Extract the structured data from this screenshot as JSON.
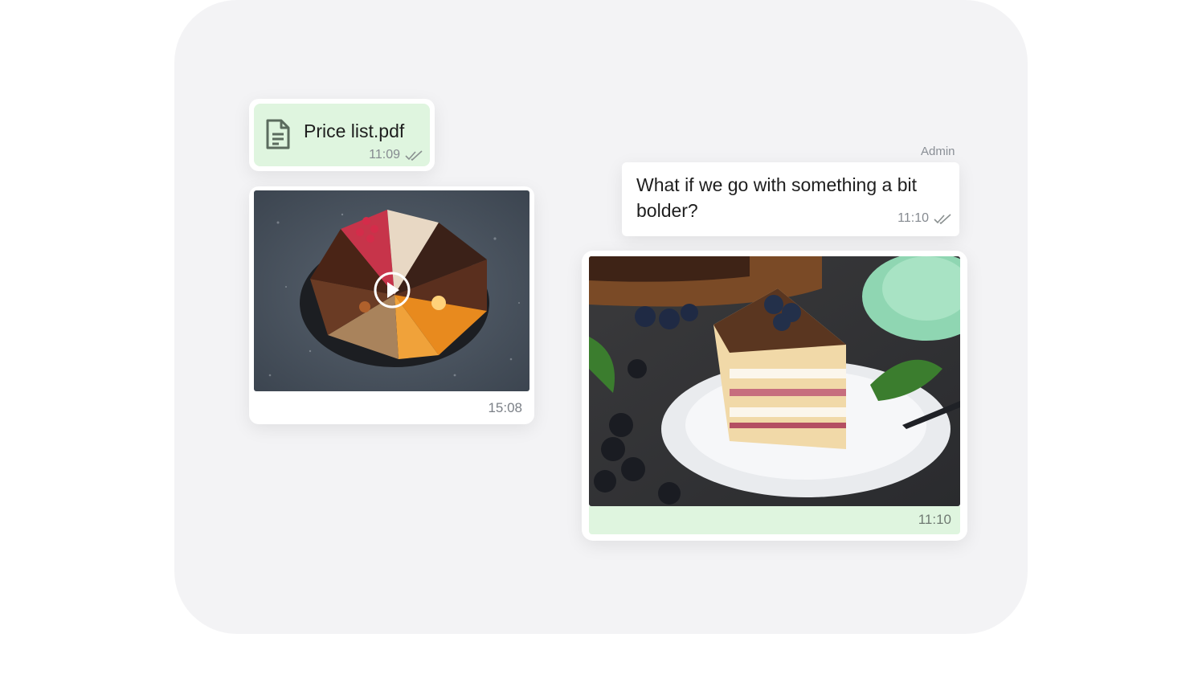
{
  "messages": {
    "file": {
      "name": "Price list.pdf",
      "time": "11:09",
      "icon": "document-icon",
      "status_icon": "double-check-icon"
    },
    "video": {
      "time": "15:08",
      "icon": "play-icon"
    },
    "admin_text": {
      "sender": "Admin",
      "text": "What if we go with something a bit bolder?",
      "time": "11:10",
      "status_icon": "double-check-icon"
    },
    "photo": {
      "time": "11:10"
    }
  },
  "colors": {
    "panel": "#f3f3f5",
    "outgoing_bubble": "#dff5df",
    "meta_text": "#858a90"
  }
}
